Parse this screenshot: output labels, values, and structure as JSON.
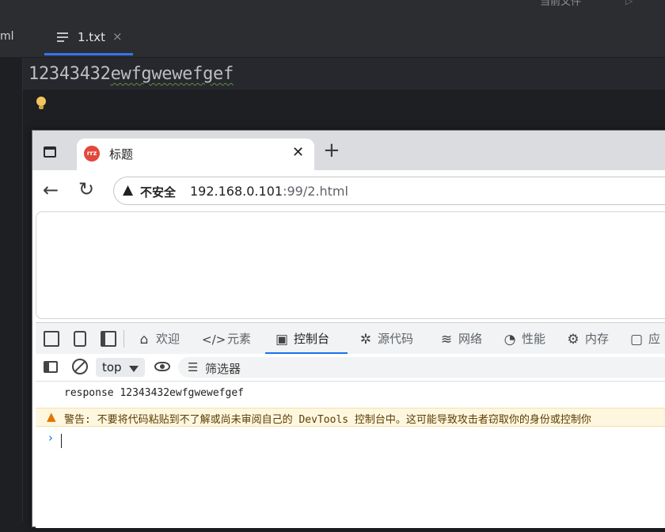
{
  "ide": {
    "top_partial": "当前文件",
    "run_glyph": "▷",
    "prev_tab_partial": "ml",
    "active_tab": "1.txt",
    "tab_close": "×",
    "code_plain": "12343432",
    "code_typo": "ewfgwewefgef"
  },
  "browser": {
    "tab_title": "标题",
    "favicon_text": "rrz",
    "tab_close": "✕",
    "new_tab": "+",
    "back": "←",
    "reload": "↻",
    "not_secure": "不安全",
    "url_host": "192.168.0.101",
    "url_rest": ":99/2.html"
  },
  "devtools": {
    "tabs": [
      {
        "icon": "⌂",
        "label": "欢迎"
      },
      {
        "icon": "</>",
        "label": "元素"
      },
      {
        "icon": "▣",
        "label": "控制台"
      },
      {
        "icon": "✲",
        "label": "源代码"
      },
      {
        "icon": "≋",
        "label": "网络"
      },
      {
        "icon": "◔",
        "label": "性能"
      },
      {
        "icon": "⚙",
        "label": "内存"
      },
      {
        "icon": "▢",
        "label": "应"
      }
    ],
    "context": "top",
    "filter_placeholder": "筛选器",
    "log_message": "response 12343432ewfgwewefgef",
    "warning": "警告: 不要将代码粘贴到不了解或尚未审阅自己的 DevTools 控制台中。这可能导致攻击者窃取你的身份或控制你",
    "prompt": "›"
  },
  "colors": {
    "ide_bg": "#1e1f22",
    "accent": "#1a73e8",
    "warning_bg": "#fef7e0",
    "favicon": "#e2483c"
  }
}
